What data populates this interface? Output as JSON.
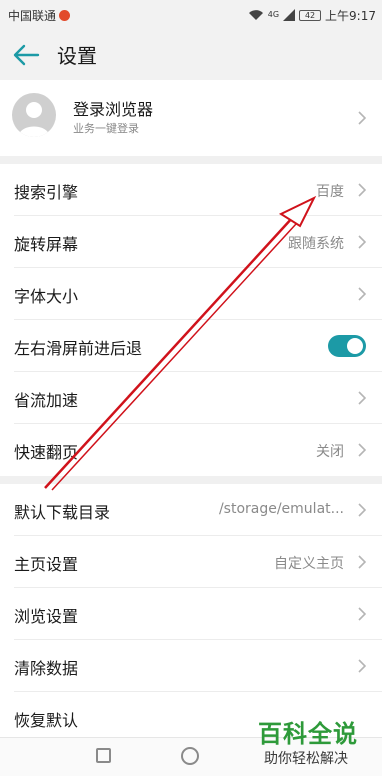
{
  "status_bar": {
    "carrier": "中国联通",
    "network": "4G",
    "battery": "42",
    "time": "上午9:17"
  },
  "header": {
    "back_icon": "arrow-left",
    "title": "设置"
  },
  "login": {
    "title": "登录浏览器",
    "subtitle": "业务一键登录"
  },
  "settings": [
    {
      "label": "搜索引擎",
      "value": "百度"
    },
    {
      "label": "旋转屏幕",
      "value": "跟随系统"
    },
    {
      "label": "字体大小",
      "value": ""
    },
    {
      "label": "左右滑屏前进后退",
      "toggle": true
    },
    {
      "label": "省流加速",
      "value": ""
    },
    {
      "label": "快速翻页",
      "value": "关闭"
    },
    {
      "label": "默认下载目录",
      "value": "/storage/emulat..."
    },
    {
      "label": "主页设置",
      "value": "自定义主页"
    },
    {
      "label": "浏览设置",
      "value": ""
    },
    {
      "label": "清除数据",
      "value": ""
    },
    {
      "label": "恢复默认",
      "value": ""
    }
  ],
  "watermark": {
    "title": "百科全说",
    "subtitle": "助你轻松解决"
  },
  "colors": {
    "accent": "#1c9aa6",
    "arrow": "#d0121b",
    "watermark": "#2e9a3a"
  }
}
